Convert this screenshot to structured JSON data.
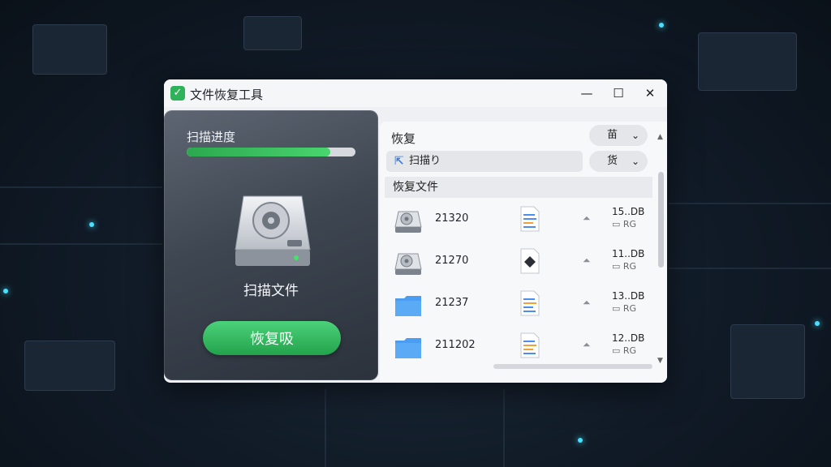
{
  "window": {
    "title": "文件恢复工具",
    "minimize_glyph": "—",
    "maximize_glyph": "☐",
    "close_glyph": "✕"
  },
  "scan_panel": {
    "progress_label": "扫描进度",
    "progress_fraction": 0.85,
    "drive_caption": "扫描文件",
    "recover_button_label": "恢复吸"
  },
  "file_panel": {
    "title": "恢复",
    "select_one": "苗",
    "select_two": "货",
    "path_text": "扫描り",
    "list_header": "恢复文件",
    "rows": [
      {
        "name": "21320",
        "size": "15..DB",
        "tag": "RG",
        "type_icon": "hard-drive-icon",
        "doc_icon": "document-icon"
      },
      {
        "name": "21270",
        "size": "11..DB",
        "tag": "RG",
        "type_icon": "hard-drive-icon",
        "doc_icon": "image-file-icon"
      },
      {
        "name": "21237",
        "size": "13..DB",
        "tag": "RG",
        "type_icon": "folder-icon",
        "doc_icon": "document-icon"
      },
      {
        "name": "211202",
        "size": "12..DB",
        "tag": "RG",
        "type_icon": "folder-icon",
        "doc_icon": "document-icon"
      }
    ]
  },
  "colors": {
    "accent_green": "#2fb35a",
    "folder_blue": "#4a9df0",
    "path_blue": "#2d7ff0"
  }
}
